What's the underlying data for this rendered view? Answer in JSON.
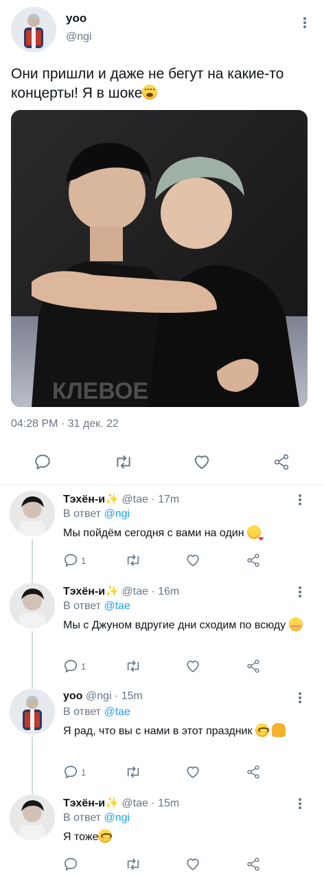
{
  "main_tweet": {
    "name": "yoo",
    "handle": "@ngi",
    "text": "Они пришли и даже не бегут на какие-то концерты! Я в шоке",
    "timestamp": "04:28 PM · 31 дек. 22",
    "photo_watermark": "КЛЕВОЕ"
  },
  "replies": [
    {
      "name": "Тэхён-и",
      "meta": "@tae · 17m",
      "reply_prefix": "В ответ",
      "reply_to": "@ngi",
      "text": "Мы пойдём сегодня с вами на один",
      "reply_count": "1",
      "emoji": "kiss"
    },
    {
      "name": "Тэхён-и",
      "meta": "@tae · 16m",
      "reply_prefix": "В ответ",
      "reply_to": "@tae",
      "text": "Мы с Джуном вдругие дни сходим по всюду",
      "reply_count": "1",
      "emoji": "blush"
    },
    {
      "name": "yoo",
      "meta": "@ngi · 15m",
      "reply_prefix": "В ответ",
      "reply_to": "@tae",
      "text": "Я рад, что вы с нами в этот праздник",
      "reply_count": "1",
      "emoji": "plead"
    },
    {
      "name": "Тэхён-и",
      "meta": "@tae · 15m",
      "reply_prefix": "В ответ",
      "reply_to": "@ngi",
      "text": "Я тоже",
      "reply_count": "",
      "emoji": "plead"
    }
  ],
  "colors": {
    "accent": "#1da1f2",
    "secondary_text": "#687684",
    "icon": "#657786",
    "sparkle": "#ffcc2f"
  },
  "icons": {
    "reply": "speech-bubble-icon",
    "retweet": "retweet-icon",
    "like": "heart-icon",
    "share": "share-icon",
    "more": "more-vertical-icon"
  }
}
